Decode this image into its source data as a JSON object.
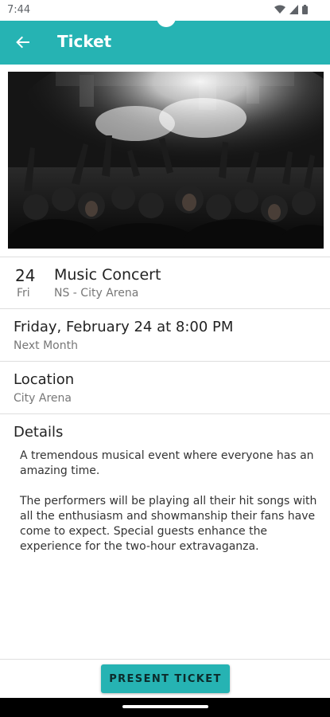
{
  "status": {
    "time": "7:44"
  },
  "colors": {
    "accent": "#26b3b3"
  },
  "app_bar": {
    "title": "Ticket",
    "back_icon": "arrow-back-icon"
  },
  "event": {
    "date_num": "24",
    "date_day": "Fri",
    "name": "Music Concert",
    "venue": "NS - City Arena"
  },
  "when": {
    "main": "Friday, February 24 at 8:00 PM",
    "sub": "Next Month"
  },
  "location": {
    "title": "Location",
    "value": "City Arena"
  },
  "details": {
    "title": "Details",
    "paragraphs": [
      "A tremendous musical event where everyone has an amazing time.",
      "The performers will be playing all their hit songs with all the enthusiasm and showmanship their fans have come to expect. Special guests enhance the experience for the two-hour extravaganza."
    ]
  },
  "actions": {
    "present_label": "PRESENT TICKET"
  }
}
